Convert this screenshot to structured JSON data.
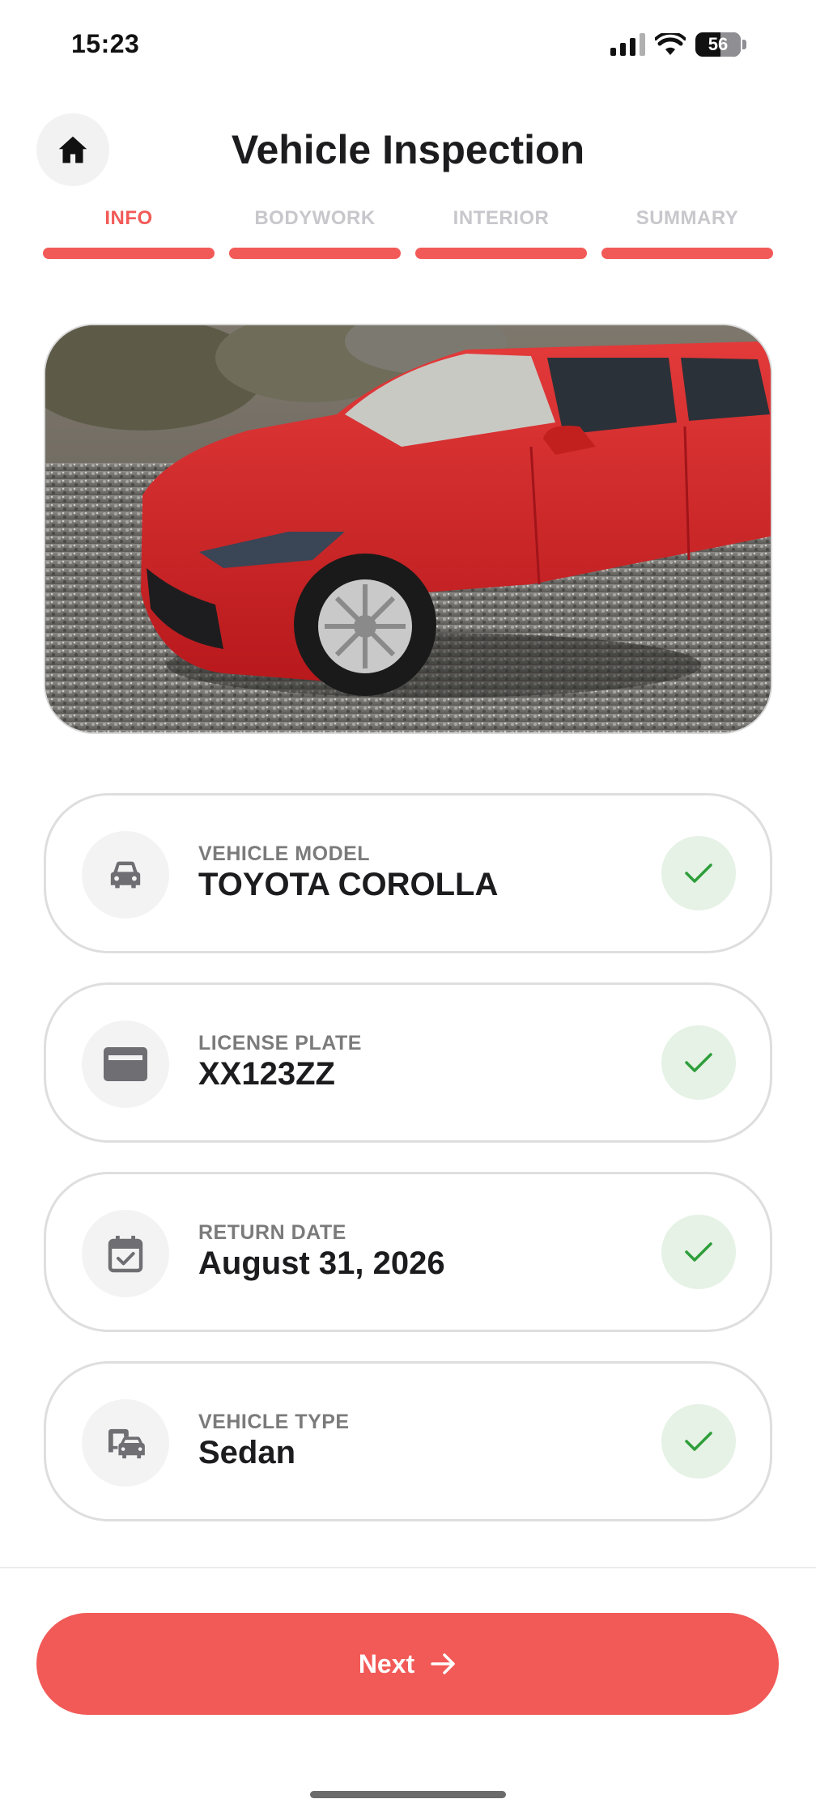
{
  "status_bar": {
    "time": "15:23",
    "battery": "56",
    "icons": [
      "signal-icon",
      "wifi-icon",
      "battery-icon"
    ]
  },
  "header": {
    "title": "Vehicle Inspection",
    "home_icon": "home-icon"
  },
  "steps": [
    {
      "label": "INFO",
      "active": true
    },
    {
      "label": "BODYWORK",
      "active": false
    },
    {
      "label": "INTERIOR",
      "active": false
    },
    {
      "label": "SUMMARY",
      "active": false
    }
  ],
  "fields": [
    {
      "label": "VEHICLE MODEL",
      "value": "TOYOTA COROLLA",
      "icon": "car-icon",
      "verified": true
    },
    {
      "label": "LICENSE PLATE",
      "value": "XX123ZZ",
      "icon": "license-plate-icon",
      "verified": true
    },
    {
      "label": "RETURN DATE",
      "value": "August 31, 2026",
      "icon": "calendar-check-icon",
      "verified": true
    },
    {
      "label": "VEHICLE TYPE",
      "value": "Sedan",
      "icon": "car-type-icon",
      "verified": true
    }
  ],
  "footer": {
    "next_label": "Next",
    "next_icon": "arrow-right-icon"
  },
  "colors": {
    "accent": "#f25a57",
    "success_bg": "#e5f2e5",
    "success": "#2e9e3a"
  }
}
